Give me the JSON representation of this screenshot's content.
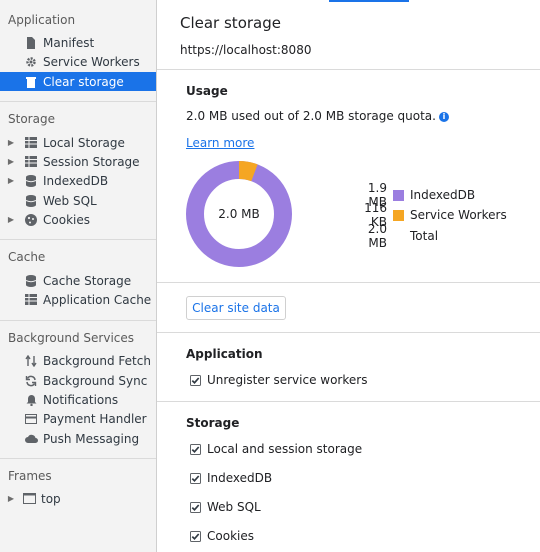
{
  "sidebar": {
    "application": {
      "header": "Application",
      "items": [
        {
          "label": "Manifest",
          "icon": "document-icon"
        },
        {
          "label": "Service Workers",
          "icon": "gear-icon"
        },
        {
          "label": "Clear storage",
          "icon": "trash-icon",
          "selected": true
        }
      ]
    },
    "storage": {
      "header": "Storage",
      "items": [
        {
          "label": "Local Storage",
          "icon": "grid-icon"
        },
        {
          "label": "Session Storage",
          "icon": "grid-icon"
        },
        {
          "label": "IndexedDB",
          "icon": "database-icon"
        },
        {
          "label": "Web SQL",
          "icon": "database-icon"
        },
        {
          "label": "Cookies",
          "icon": "cookie-icon"
        }
      ]
    },
    "cache": {
      "header": "Cache",
      "items": [
        {
          "label": "Cache Storage",
          "icon": "database-icon"
        },
        {
          "label": "Application Cache",
          "icon": "grid-icon"
        }
      ]
    },
    "background": {
      "header": "Background Services",
      "items": [
        {
          "label": "Background Fetch",
          "icon": "up-down-arrows-icon"
        },
        {
          "label": "Background Sync",
          "icon": "sync-icon"
        },
        {
          "label": "Notifications",
          "icon": "bell-icon"
        },
        {
          "label": "Payment Handler",
          "icon": "card-icon"
        },
        {
          "label": "Push Messaging",
          "icon": "cloud-icon"
        }
      ]
    },
    "frames": {
      "header": "Frames",
      "items": [
        {
          "label": "top",
          "icon": "frame-icon"
        }
      ]
    }
  },
  "main": {
    "title": "Clear storage",
    "origin": "https://localhost:8080",
    "usage": {
      "heading": "Usage",
      "summary": "2.0 MB used out of 2.0 MB storage quota.",
      "learn_more": "Learn more",
      "total_label": "2.0 MB",
      "legend": [
        {
          "value": "1.9 MB",
          "label": "IndexedDB",
          "color": "#9b7ee0"
        },
        {
          "value": "116 KB",
          "label": "Service Workers",
          "color": "#f5a623"
        },
        {
          "value": "2.0 MB",
          "label": "Total"
        }
      ],
      "service_workers_fraction": 0.057
    },
    "clear_button": "Clear site data",
    "application": {
      "heading": "Application",
      "options": [
        {
          "label": "Unregister service workers",
          "checked": true
        }
      ]
    },
    "storage": {
      "heading": "Storage",
      "options": [
        {
          "label": "Local and session storage",
          "checked": true
        },
        {
          "label": "IndexedDB",
          "checked": true
        },
        {
          "label": "Web SQL",
          "checked": true
        },
        {
          "label": "Cookies",
          "checked": true
        }
      ]
    }
  },
  "colors": {
    "accent": "#1a73e8",
    "indexeddb": "#9b7ee0",
    "service_workers": "#f5a623"
  }
}
